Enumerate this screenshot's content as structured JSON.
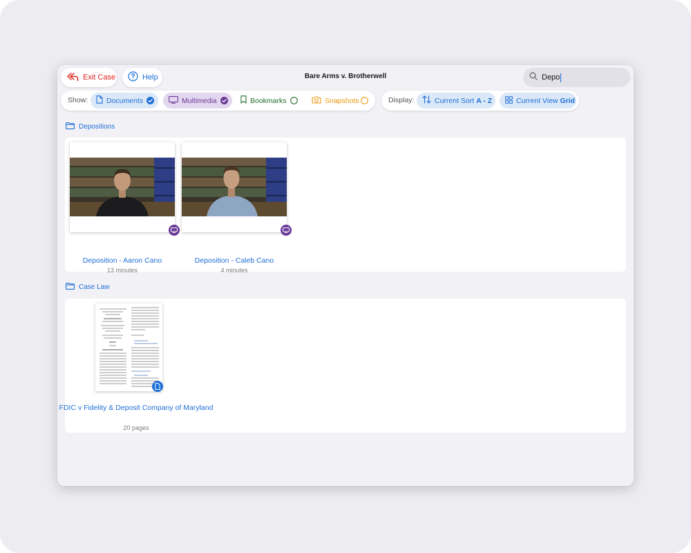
{
  "toolbar": {
    "exit_label": "Exit Case",
    "help_label": "Help",
    "case_title": "Bare Arms v. Brotherwell",
    "search": {
      "value": "Depo",
      "icon": "search-icon"
    }
  },
  "filters": {
    "show_label": "Show:",
    "chips": [
      {
        "label": "Documents",
        "state": "checked",
        "color": "#1d6fd6"
      },
      {
        "label": "Multimedia",
        "state": "checked",
        "color": "#6a3a98"
      },
      {
        "label": "Bookmarks",
        "state": "unchecked",
        "color": "#1e6b2c"
      },
      {
        "label": "Snapshots",
        "state": "unchecked",
        "color": "#e9990b"
      }
    ]
  },
  "display": {
    "label": "Display:",
    "sort_prefix": "Current Sort",
    "sort_value": "A - Z",
    "view_prefix": "Current View",
    "view_value": "Grid"
  },
  "sections": [
    {
      "name": "Depositions",
      "items": [
        {
          "title": "Deposition - Aaron Cano",
          "subtitle": "13 minutes",
          "type": "multimedia"
        },
        {
          "title": "Deposition - Caleb Cano",
          "subtitle": "4 minutes",
          "type": "multimedia"
        }
      ]
    },
    {
      "name": "Case Law",
      "items": [
        {
          "title": "FDIC v Fidelity & Deposit Company of Maryland",
          "subtitle": "20 pages",
          "type": "document"
        }
      ]
    }
  ],
  "colors": {
    "accent": "#1d6fd6",
    "danger": "#e0241e",
    "multimedia": "#6a3a98"
  }
}
